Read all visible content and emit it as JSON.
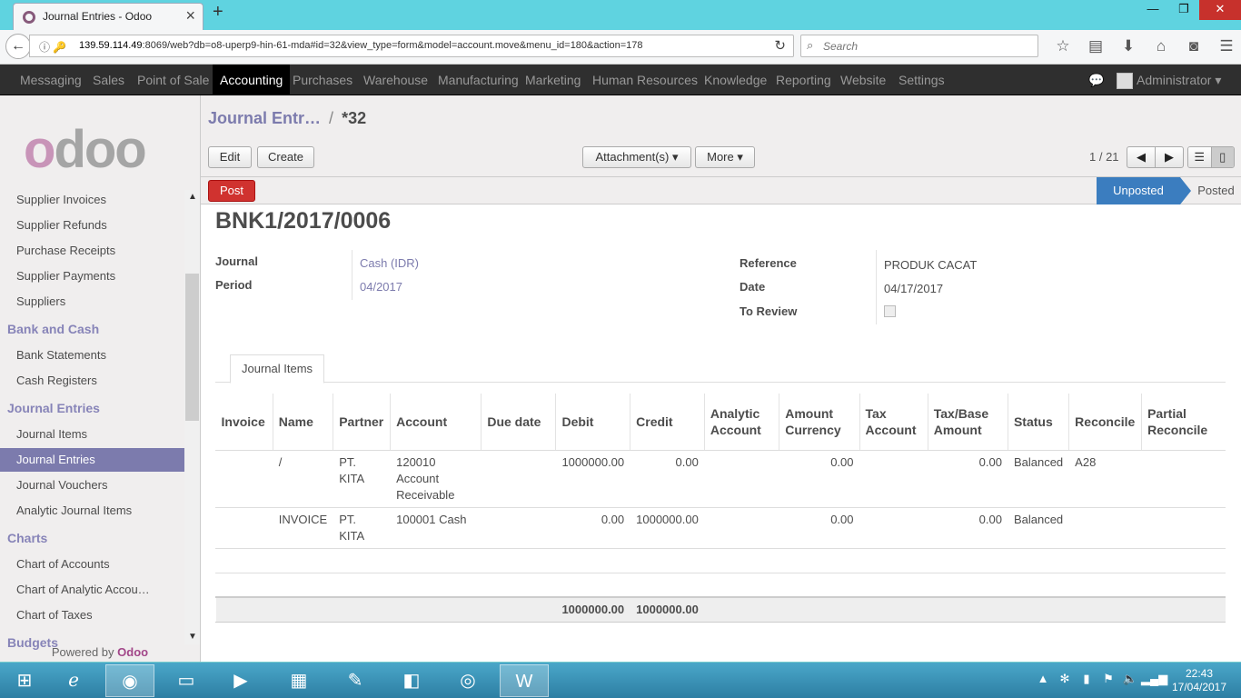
{
  "browser": {
    "tab_title": "Journal Entries - Odoo",
    "url_host": "139.59.114.49",
    "url_rest": ":8069/web?db=o8-uperp9-hin-61-mda#id=32&view_type=form&model=account.move&menu_id=180&action=178",
    "search_placeholder": "Search"
  },
  "topmenu": {
    "items": [
      "Messaging",
      "Sales",
      "Point of Sale",
      "Accounting",
      "Purchases",
      "Warehouse",
      "Manufacturing",
      "Marketing",
      "Human Resources",
      "Knowledge",
      "Reporting",
      "Website",
      "Settings"
    ],
    "active": "Accounting",
    "user": "Administrator"
  },
  "sidebar": {
    "logo": "odoo",
    "powered_by": "Powered by",
    "powered_brand": "Odoo",
    "items": [
      {
        "type": "item",
        "label": "Supplier Invoices"
      },
      {
        "type": "item",
        "label": "Supplier Refunds"
      },
      {
        "type": "item",
        "label": "Purchase Receipts"
      },
      {
        "type": "item",
        "label": "Supplier Payments"
      },
      {
        "type": "item",
        "label": "Suppliers"
      },
      {
        "type": "section",
        "label": "Bank and Cash"
      },
      {
        "type": "item",
        "label": "Bank Statements"
      },
      {
        "type": "item",
        "label": "Cash Registers"
      },
      {
        "type": "section",
        "label": "Journal Entries"
      },
      {
        "type": "item",
        "label": "Journal Items"
      },
      {
        "type": "item",
        "label": "Journal Entries",
        "active": true
      },
      {
        "type": "item",
        "label": "Journal Vouchers"
      },
      {
        "type": "item",
        "label": "Analytic Journal Items"
      },
      {
        "type": "section",
        "label": "Charts"
      },
      {
        "type": "item",
        "label": "Chart of Accounts"
      },
      {
        "type": "item",
        "label": "Chart of Analytic Accou…"
      },
      {
        "type": "item",
        "label": "Chart of Taxes"
      },
      {
        "type": "section",
        "label": "Budgets"
      }
    ]
  },
  "control_panel": {
    "breadcrumb_link": "Journal Entr…",
    "breadcrumb_sep": "/",
    "breadcrumb_current": "*32",
    "edit_label": "Edit",
    "create_label": "Create",
    "attachments_label": "Attachment(s) ▾",
    "more_label": "More ▾",
    "pager": "1 / 21"
  },
  "statusbar": {
    "post_label": "Post",
    "states": [
      "Unposted",
      "Posted"
    ],
    "current_state": "Unposted"
  },
  "form": {
    "name": "BNK1/2017/0006",
    "journal_label": "Journal",
    "journal_value": "Cash (IDR)",
    "period_label": "Period",
    "period_value": "04/2017",
    "reference_label": "Reference",
    "reference_value": "PRODUK CACAT",
    "date_label": "Date",
    "date_value": "04/17/2017",
    "to_review_label": "To Review",
    "tab_label": "Journal Items"
  },
  "grid": {
    "headers": [
      "Invoice",
      "Name",
      "Partner",
      "Account",
      "Due date",
      "Debit",
      "Credit",
      "Analytic Account",
      "Amount Currency",
      "Tax Account",
      "Tax/Base Amount",
      "Status",
      "Reconcile",
      "Partial Reconcile"
    ],
    "rows": [
      [
        "",
        "/",
        "PT. KITA",
        "120010 Account Receivable",
        "",
        "1000000.00",
        "0.00",
        "",
        "0.00",
        "",
        "0.00",
        "Balanced",
        "A28",
        ""
      ],
      [
        "",
        "INVOICE",
        "PT. KITA",
        "100001 Cash",
        "",
        "0.00",
        "1000000.00",
        "",
        "0.00",
        "",
        "0.00",
        "Balanced",
        "",
        ""
      ]
    ],
    "total_debit": "1000000.00",
    "total_credit": "1000000.00"
  },
  "taskbar": {
    "time": "22:43",
    "date": "17/04/2017"
  }
}
